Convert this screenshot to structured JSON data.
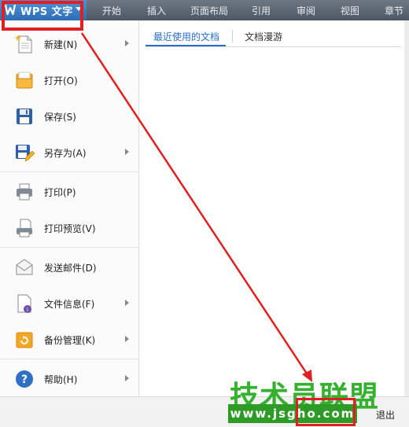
{
  "app_button": {
    "label": "WPS 文字"
  },
  "ribbon_tabs": [
    "开始",
    "插入",
    "页面布局",
    "引用",
    "审阅",
    "视图",
    "章节"
  ],
  "menu": {
    "items": [
      {
        "label": "新建(N)",
        "icon": "new-document-icon",
        "submenu": true
      },
      {
        "label": "打开(O)",
        "icon": "open-folder-icon",
        "submenu": false
      },
      {
        "label": "保存(S)",
        "icon": "save-disk-icon",
        "submenu": false
      },
      {
        "label": "另存为(A)",
        "icon": "save-as-icon",
        "submenu": true
      },
      {
        "label": "打印(P)",
        "icon": "printer-icon",
        "submenu": false
      },
      {
        "label": "打印预览(V)",
        "icon": "print-preview-icon",
        "submenu": false
      },
      {
        "label": "发送邮件(D)",
        "icon": "envelope-icon",
        "submenu": false
      },
      {
        "label": "文件信息(F)",
        "icon": "file-info-icon",
        "submenu": true
      },
      {
        "label": "备份管理(K)",
        "icon": "backup-icon",
        "submenu": true
      },
      {
        "label": "帮助(H)",
        "icon": "help-icon",
        "submenu": true
      }
    ]
  },
  "right_pane": {
    "tabs": [
      "最近使用的文档",
      "文档漫游"
    ],
    "active_tab": 0
  },
  "bottom": {
    "exit_label": "退出"
  },
  "watermark": {
    "title": "技术员联盟",
    "url": "www.jsgho.com"
  },
  "colors": {
    "accent": "#2a6fc9",
    "annotation": "#e02020",
    "watermark": "#35b02f"
  }
}
